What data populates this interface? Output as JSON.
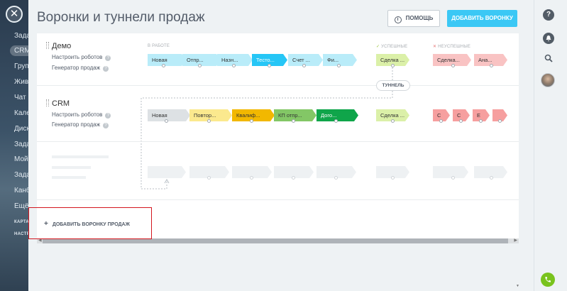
{
  "sidebar": {
    "close": "✕",
    "items": [
      {
        "label": "Задачи"
      },
      {
        "label": "CRM",
        "active": true
      },
      {
        "label": "Группы"
      },
      {
        "label": "Живая лента"
      },
      {
        "label": "Чат и звонки"
      },
      {
        "label": "Календарь"
      },
      {
        "label": "Диск"
      },
      {
        "label": "Задачи"
      },
      {
        "label": "Мой"
      },
      {
        "label": "Задачи"
      },
      {
        "label": "Канбан"
      },
      {
        "label": "Ещё"
      }
    ],
    "footer": [
      "КАРТА",
      "НАСТРОЙКИ"
    ]
  },
  "header": {
    "title": "Воронки и туннели продаж",
    "help_label": "ПОМОЩЬ",
    "add_label": "ДОБАВИТЬ ВОРОНКУ"
  },
  "categories": {
    "in_work": "В РАБОТЕ",
    "success": "УСПЕШНЫЕ",
    "fail": "НЕУСПЕШНЫЕ"
  },
  "funnels": [
    {
      "name": "Демо",
      "links": [
        "Настроить роботов",
        "Генератор продаж"
      ],
      "stages": [
        {
          "label": "Новая",
          "color": "#b9ecf9"
        },
        {
          "label": "Отпр...",
          "color": "#b9ecf9"
        },
        {
          "label": "Назн...",
          "color": "#b9ecf9"
        },
        {
          "label": "Тесто...",
          "color": "#26c6f6",
          "text": "#ffffff"
        },
        {
          "label": "Счет ...",
          "color": "#b9ecf9"
        },
        {
          "label": "Фи...",
          "color": "#b9ecf9"
        }
      ],
      "success": [
        {
          "label": "Сделка ...",
          "color": "#dbf0a8"
        }
      ],
      "fail": [
        {
          "label": "Сделка...",
          "color": "#f9c3c3"
        },
        {
          "label": "Ана...",
          "color": "#f9c3c3"
        }
      ]
    },
    {
      "name": "CRM",
      "links": [
        "Настроить роботов",
        "Генератор продаж"
      ],
      "stages": [
        {
          "label": "Новая",
          "color": "#dde1e4"
        },
        {
          "label": "Повтор...",
          "color": "#fbe98e"
        },
        {
          "label": "Квалиф...",
          "color": "#f2b800"
        },
        {
          "label": "КП отпр...",
          "color": "#83c766"
        },
        {
          "label": "Дого...",
          "color": "#0fa54a",
          "text": "#ffffff"
        }
      ],
      "success": [
        {
          "label": "Сделка ...",
          "color": "#dbf0a8"
        }
      ],
      "fail": [
        {
          "label": "С",
          "color": "#f69f9f"
        },
        {
          "label": "С",
          "color": "#f69f9f"
        },
        {
          "label": "Е",
          "color": "#f69f9f"
        },
        {
          "label": "",
          "color": "#f69f9f"
        }
      ]
    }
  ],
  "tunnel_label": "ТУННЕЛЬ",
  "add_funnel": {
    "plus": "+",
    "label": "ДОБАВИТЬ ВОРОНКУ ПРОДАЖ"
  },
  "rightbar": {
    "help": "?",
    "bell": "bell-icon",
    "search": "search-icon",
    "avatar": "avatar",
    "phone": "phone-icon"
  }
}
